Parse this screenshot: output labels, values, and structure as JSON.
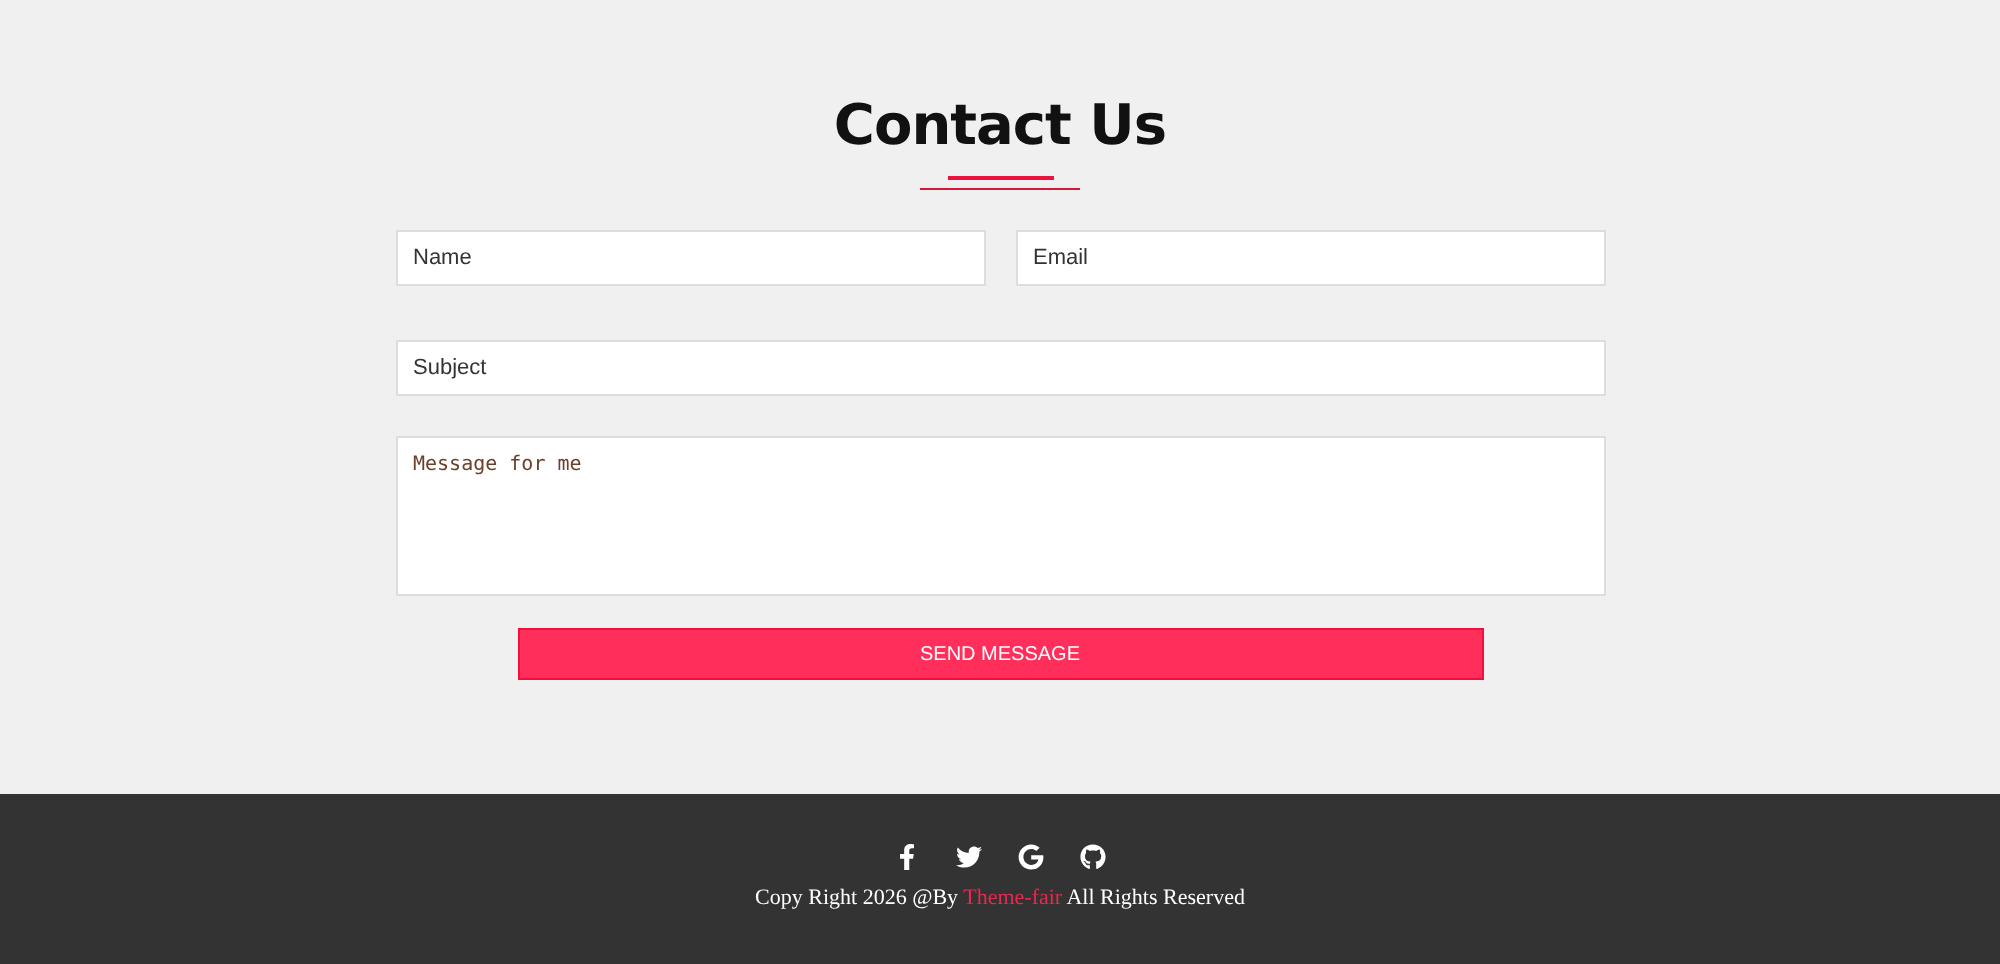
{
  "heading": "Contact Us",
  "form": {
    "name": {
      "placeholder": "Name"
    },
    "email": {
      "placeholder": "Email"
    },
    "subject": {
      "placeholder": "Subject"
    },
    "message": {
      "placeholder": "Message for me"
    },
    "submit": "SEND MESSAGE"
  },
  "footer": {
    "social": [
      {
        "kind": "facebook"
      },
      {
        "kind": "twitter"
      },
      {
        "kind": "google"
      },
      {
        "kind": "github"
      }
    ],
    "copyright": {
      "before": "Copy Right 2026 @By",
      "link": "Theme-fair",
      "after": "All Rights Reserved"
    }
  }
}
